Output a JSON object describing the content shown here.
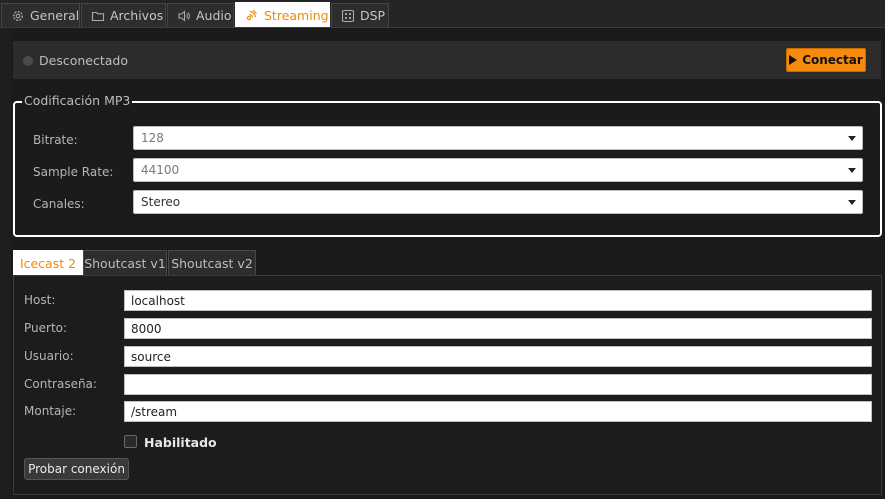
{
  "top_tabs": [
    {
      "label": "General",
      "icon": "gear-icon"
    },
    {
      "label": "Archivos",
      "icon": "folder-icon"
    },
    {
      "label": "Audio",
      "icon": "speaker-icon"
    },
    {
      "label": "Streaming",
      "icon": "broadcast-icon",
      "active": true
    },
    {
      "label": "DSP",
      "icon": "dsp-icon"
    }
  ],
  "status": {
    "text": "Desconectado",
    "connect_label": "Conectar"
  },
  "mp3": {
    "title": "Codificación MP3",
    "bitrate": {
      "label": "Bitrate:",
      "value": "128"
    },
    "sample_rate": {
      "label": "Sample Rate:",
      "value": "44100"
    },
    "channels": {
      "label": "Canales:",
      "value": "Stereo"
    }
  },
  "server_tabs": [
    {
      "label": "Icecast 2",
      "active": true
    },
    {
      "label": "Shoutcast v1"
    },
    {
      "label": "Shoutcast v2"
    }
  ],
  "server": {
    "host": {
      "label": "Host:",
      "value": "localhost"
    },
    "port": {
      "label": "Puerto:",
      "value": "8000"
    },
    "user": {
      "label": "Usuario:",
      "value": "source"
    },
    "password": {
      "label": "Contraseña:",
      "value": ""
    },
    "mount": {
      "label": "Montaje:",
      "value": "/stream"
    },
    "enabled_label": "Habilitado",
    "test_label": "Probar conexión"
  },
  "colors": {
    "accent": "#f58a0c",
    "background": "#1b1b1b"
  }
}
